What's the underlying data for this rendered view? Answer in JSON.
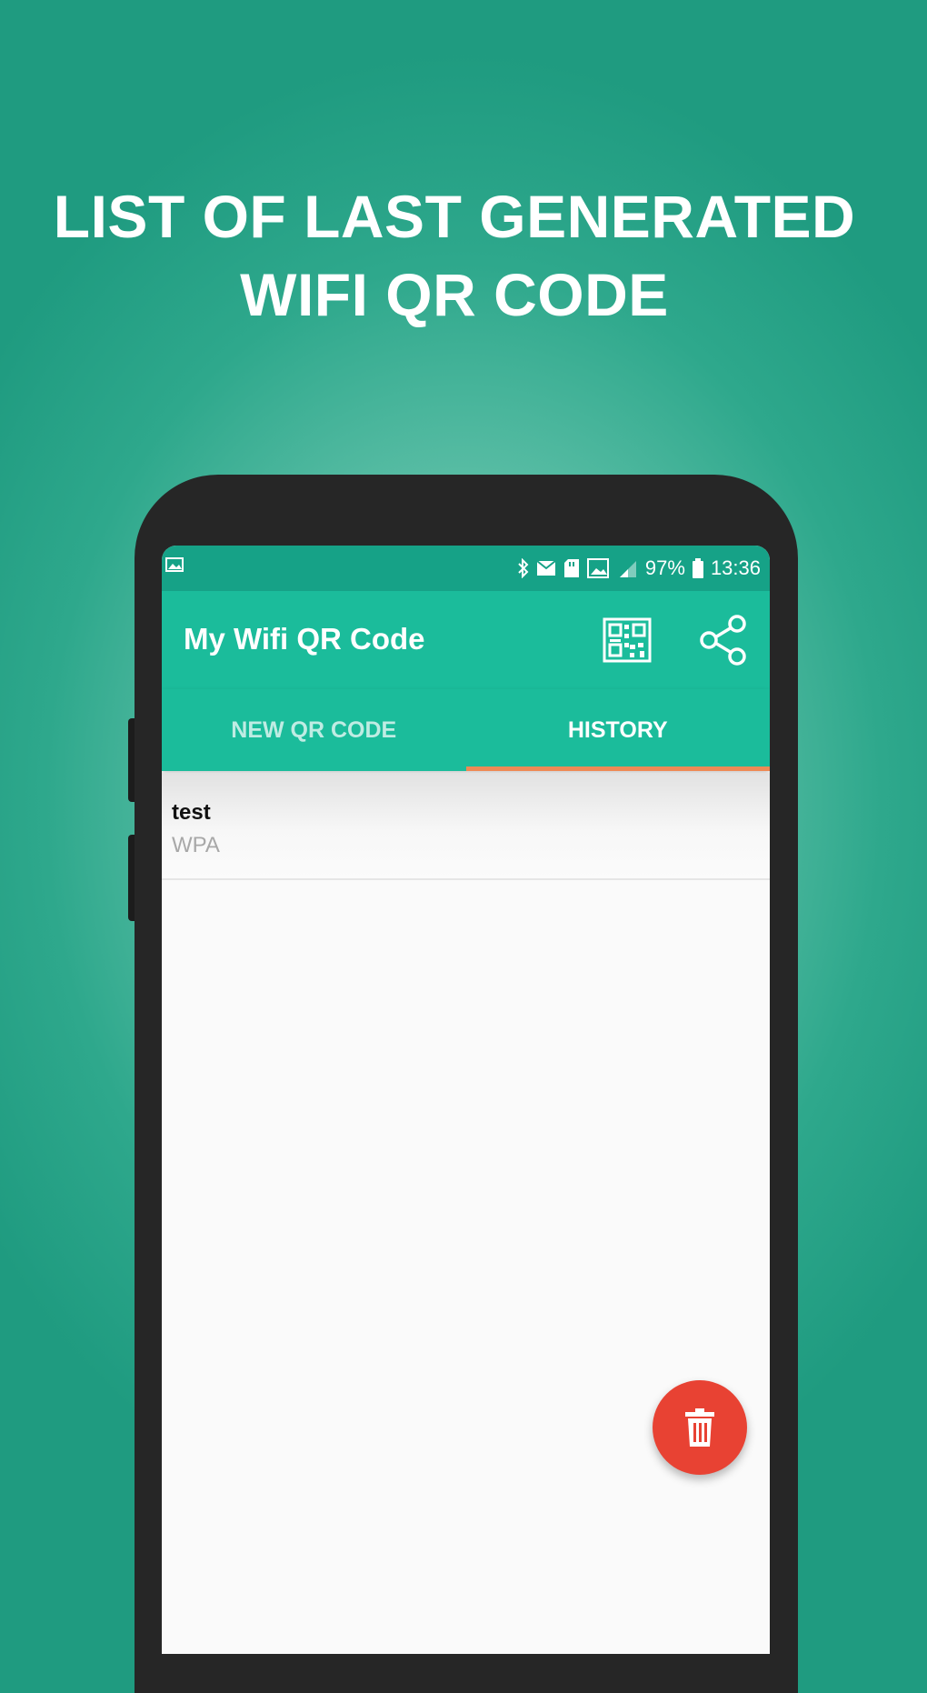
{
  "headline": {
    "line1": "LIST OF LAST GENERATED",
    "line2": "WIFI QR CODE"
  },
  "status_bar": {
    "battery_percent": "97%",
    "time": "13:36",
    "icons": [
      "image-icon",
      "bluetooth-icon",
      "mail-icon",
      "sd-card-icon",
      "gallery-icon",
      "signal-icon",
      "battery-icon"
    ]
  },
  "app_bar": {
    "title": "My Wifi QR Code",
    "actions": [
      "qr-scan-icon",
      "share-icon"
    ]
  },
  "tabs": [
    {
      "label": "NEW QR CODE",
      "active": false
    },
    {
      "label": "HISTORY",
      "active": true
    }
  ],
  "history": [
    {
      "name": "test",
      "security": "WPA"
    }
  ],
  "fab": {
    "icon": "trash-icon"
  },
  "colors": {
    "background": "#2ea88c",
    "status_bar": "#16a287",
    "primary": "#1bbc9b",
    "tab_indicator": "#ee8a55",
    "fab": "#e84233",
    "phone_frame": "#262626"
  }
}
